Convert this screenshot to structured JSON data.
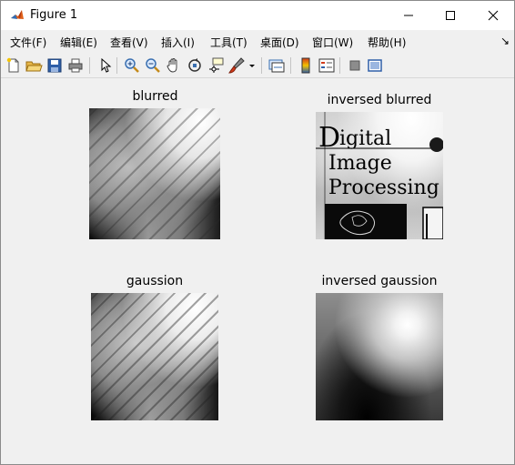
{
  "window": {
    "title": "Figure 1"
  },
  "menu": {
    "items": [
      "文件(F)",
      "编辑(E)",
      "查看(V)",
      "插入(I)",
      "工具(T)",
      "桌面(D)",
      "窗口(W)",
      "帮助(H)"
    ],
    "overflow_glyph": "↘"
  },
  "toolbar": {
    "buttons": [
      "new-figure-icon",
      "open-file-icon",
      "save-icon",
      "print-icon",
      "edit-plot-arrow-icon",
      "zoom-in-icon",
      "zoom-out-icon",
      "pan-hand-icon",
      "rotate-3d-icon",
      "data-cursor-icon",
      "brush-icon",
      "brush-dropdown-icon",
      "link-plot-icon",
      "colorbar-icon",
      "legend-icon",
      "hide-plot-tools-icon",
      "show-plot-tools-icon"
    ]
  },
  "subplots": [
    {
      "title": "blurred"
    },
    {
      "title": "inversed blurred"
    },
    {
      "title": "gaussion"
    },
    {
      "title": "inversed gaussion"
    }
  ],
  "embedded_image_text": {
    "line1_initial": "D",
    "line1_rest": "igital",
    "line2": "Image",
    "line3": "Processing"
  }
}
